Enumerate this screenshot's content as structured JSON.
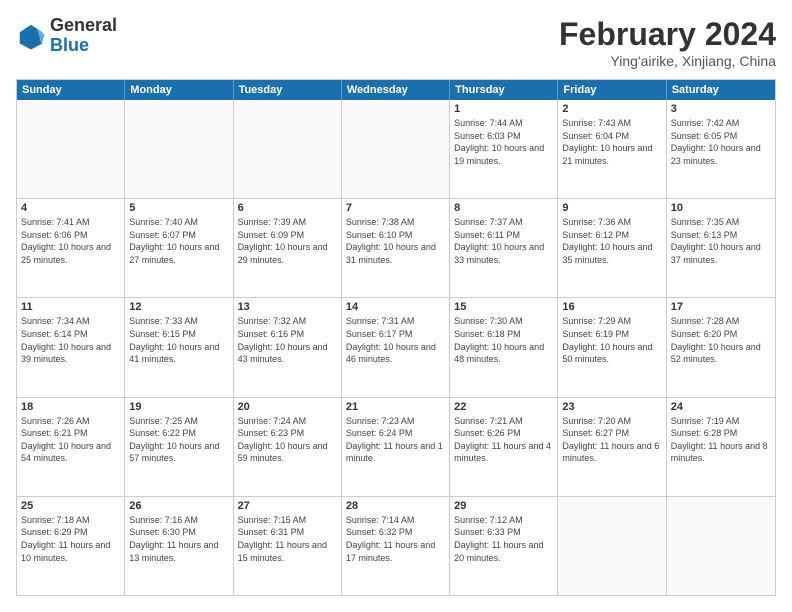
{
  "header": {
    "logo": {
      "general": "General",
      "blue": "Blue"
    },
    "title": "February 2024",
    "subtitle": "Ying'airike, Xinjiang, China"
  },
  "calendar": {
    "days_of_week": [
      "Sunday",
      "Monday",
      "Tuesday",
      "Wednesday",
      "Thursday",
      "Friday",
      "Saturday"
    ],
    "weeks": [
      [
        {
          "day": "",
          "empty": true
        },
        {
          "day": "",
          "empty": true
        },
        {
          "day": "",
          "empty": true
        },
        {
          "day": "",
          "empty": true
        },
        {
          "day": "1",
          "sunrise": "7:44 AM",
          "sunset": "6:03 PM",
          "daylight": "10 hours and 19 minutes."
        },
        {
          "day": "2",
          "sunrise": "7:43 AM",
          "sunset": "6:04 PM",
          "daylight": "10 hours and 21 minutes."
        },
        {
          "day": "3",
          "sunrise": "7:42 AM",
          "sunset": "6:05 PM",
          "daylight": "10 hours and 23 minutes."
        }
      ],
      [
        {
          "day": "4",
          "sunrise": "7:41 AM",
          "sunset": "6:06 PM",
          "daylight": "10 hours and 25 minutes."
        },
        {
          "day": "5",
          "sunrise": "7:40 AM",
          "sunset": "6:07 PM",
          "daylight": "10 hours and 27 minutes."
        },
        {
          "day": "6",
          "sunrise": "7:39 AM",
          "sunset": "6:09 PM",
          "daylight": "10 hours and 29 minutes."
        },
        {
          "day": "7",
          "sunrise": "7:38 AM",
          "sunset": "6:10 PM",
          "daylight": "10 hours and 31 minutes."
        },
        {
          "day": "8",
          "sunrise": "7:37 AM",
          "sunset": "6:11 PM",
          "daylight": "10 hours and 33 minutes."
        },
        {
          "day": "9",
          "sunrise": "7:36 AM",
          "sunset": "6:12 PM",
          "daylight": "10 hours and 35 minutes."
        },
        {
          "day": "10",
          "sunrise": "7:35 AM",
          "sunset": "6:13 PM",
          "daylight": "10 hours and 37 minutes."
        }
      ],
      [
        {
          "day": "11",
          "sunrise": "7:34 AM",
          "sunset": "6:14 PM",
          "daylight": "10 hours and 39 minutes."
        },
        {
          "day": "12",
          "sunrise": "7:33 AM",
          "sunset": "6:15 PM",
          "daylight": "10 hours and 41 minutes."
        },
        {
          "day": "13",
          "sunrise": "7:32 AM",
          "sunset": "6:16 PM",
          "daylight": "10 hours and 43 minutes."
        },
        {
          "day": "14",
          "sunrise": "7:31 AM",
          "sunset": "6:17 PM",
          "daylight": "10 hours and 46 minutes."
        },
        {
          "day": "15",
          "sunrise": "7:30 AM",
          "sunset": "6:18 PM",
          "daylight": "10 hours and 48 minutes."
        },
        {
          "day": "16",
          "sunrise": "7:29 AM",
          "sunset": "6:19 PM",
          "daylight": "10 hours and 50 minutes."
        },
        {
          "day": "17",
          "sunrise": "7:28 AM",
          "sunset": "6:20 PM",
          "daylight": "10 hours and 52 minutes."
        }
      ],
      [
        {
          "day": "18",
          "sunrise": "7:26 AM",
          "sunset": "6:21 PM",
          "daylight": "10 hours and 54 minutes."
        },
        {
          "day": "19",
          "sunrise": "7:25 AM",
          "sunset": "6:22 PM",
          "daylight": "10 hours and 57 minutes."
        },
        {
          "day": "20",
          "sunrise": "7:24 AM",
          "sunset": "6:23 PM",
          "daylight": "10 hours and 59 minutes."
        },
        {
          "day": "21",
          "sunrise": "7:23 AM",
          "sunset": "6:24 PM",
          "daylight": "11 hours and 1 minute."
        },
        {
          "day": "22",
          "sunrise": "7:21 AM",
          "sunset": "6:26 PM",
          "daylight": "11 hours and 4 minutes."
        },
        {
          "day": "23",
          "sunrise": "7:20 AM",
          "sunset": "6:27 PM",
          "daylight": "11 hours and 6 minutes."
        },
        {
          "day": "24",
          "sunrise": "7:19 AM",
          "sunset": "6:28 PM",
          "daylight": "11 hours and 8 minutes."
        }
      ],
      [
        {
          "day": "25",
          "sunrise": "7:18 AM",
          "sunset": "6:29 PM",
          "daylight": "11 hours and 10 minutes."
        },
        {
          "day": "26",
          "sunrise": "7:16 AM",
          "sunset": "6:30 PM",
          "daylight": "11 hours and 13 minutes."
        },
        {
          "day": "27",
          "sunrise": "7:15 AM",
          "sunset": "6:31 PM",
          "daylight": "11 hours and 15 minutes."
        },
        {
          "day": "28",
          "sunrise": "7:14 AM",
          "sunset": "6:32 PM",
          "daylight": "11 hours and 17 minutes."
        },
        {
          "day": "29",
          "sunrise": "7:12 AM",
          "sunset": "6:33 PM",
          "daylight": "11 hours and 20 minutes."
        },
        {
          "day": "",
          "empty": true
        },
        {
          "day": "",
          "empty": true
        }
      ]
    ]
  }
}
